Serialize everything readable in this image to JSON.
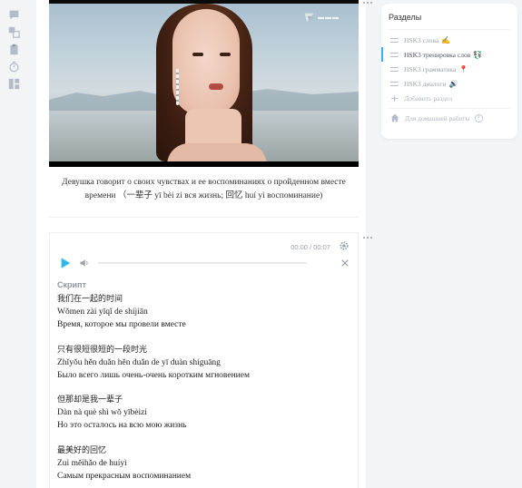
{
  "video": {
    "caption_line1": "Девушка говорит о своих чувствах и ее воспоминаниях о пройденном вместе",
    "caption_line2": "времени （一辈子 yī bèi zi вся жизнь; 回忆 huí yì воспоминание)"
  },
  "player": {
    "time": "00:00 / 00:07",
    "progress": 0.0
  },
  "script": {
    "heading": "Скрипт",
    "lines": [
      {
        "cn": "我们在一起的时间",
        "py": "Wǒmen zài yīqǐ de shíjiān",
        "ru": "Время, которое мы провели вместе"
      },
      {
        "cn": "只有很短很短的一段时光",
        "py": "Zhǐyǒu hěn duǎn hěn duǎn de yī duàn shíguāng",
        "ru": "Было всего лишь очень-очень коротким мгновением"
      },
      {
        "cn": "但那却是我一辈子",
        "py": "Dàn nà què shì wǒ yībèizi",
        "ru": "Но это осталось на всю мою жизнь"
      },
      {
        "cn": "最美好的回忆",
        "py": "Zuì měihǎo de huíyì",
        "ru": "Самым прекрасным воспоминанием"
      }
    ]
  },
  "sidebar": {
    "title": "Разделы",
    "items": [
      {
        "label": "HSK3 слова",
        "emoji": "✍️",
        "active": false
      },
      {
        "label": "HSK3 тренировка слов",
        "emoji": "💱",
        "active": true
      },
      {
        "label": "HSK3 грамматика",
        "emoji": "📍",
        "active": false
      },
      {
        "label": "HSK3 диалоги",
        "emoji": "🔊",
        "active": false
      }
    ],
    "add_label": "Добавить раздел",
    "home_label": "Для домашней работы",
    "help_glyph": "?"
  },
  "colors": {
    "accent": "#31b7ea",
    "muted": "#9aa0aa"
  }
}
